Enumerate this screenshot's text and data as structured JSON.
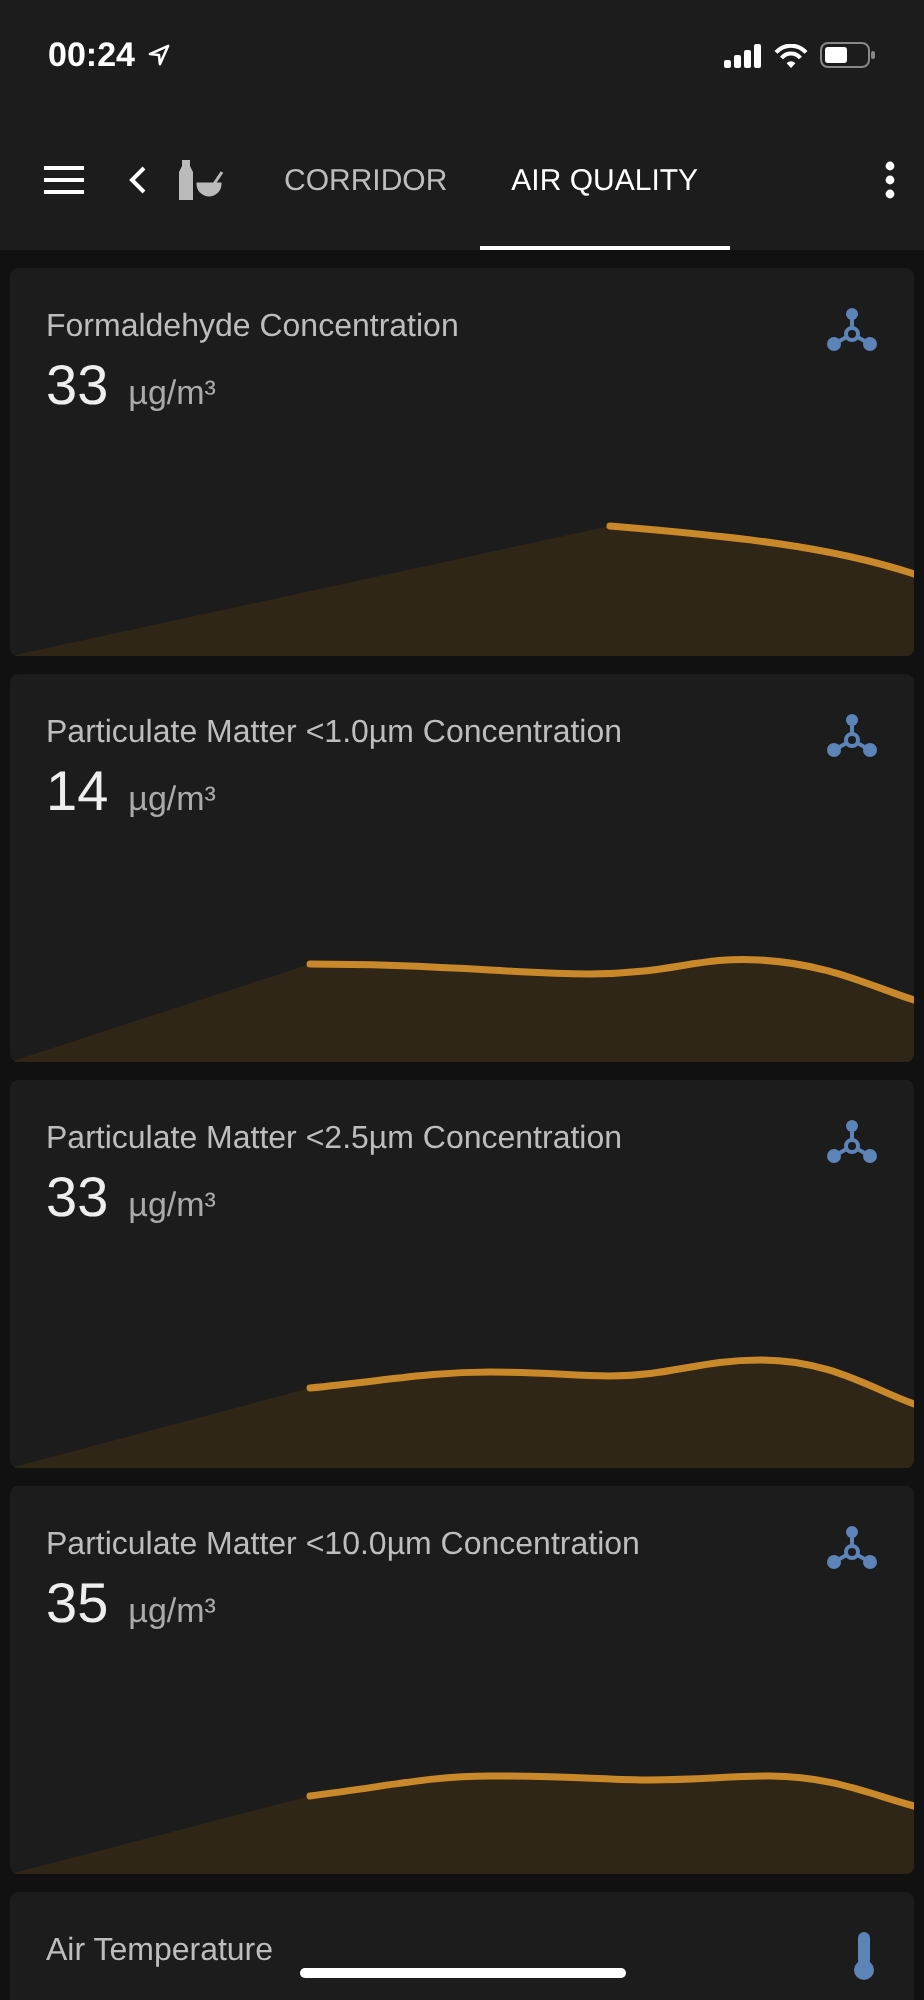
{
  "status_bar": {
    "time": "00:24"
  },
  "toolbar": {
    "tabs": [
      {
        "label": "CORRIDOR",
        "selected": false
      },
      {
        "label": "AIR QUALITY",
        "selected": true
      }
    ]
  },
  "cards": [
    {
      "kind": "concentration",
      "title": "Formaldehyde Concentration",
      "value": "33",
      "unit": "µg/m³"
    },
    {
      "kind": "concentration",
      "title": "Particulate Matter <1.0µm Concentration",
      "value": "14",
      "unit": "µg/m³"
    },
    {
      "kind": "concentration",
      "title": "Particulate Matter <2.5µm Concentration",
      "value": "33",
      "unit": "µg/m³"
    },
    {
      "kind": "concentration",
      "title": "Particulate Matter <10.0µm Concentration",
      "value": "35",
      "unit": "µg/m³"
    },
    {
      "kind": "temperature",
      "title": "Air Temperature"
    }
  ]
}
